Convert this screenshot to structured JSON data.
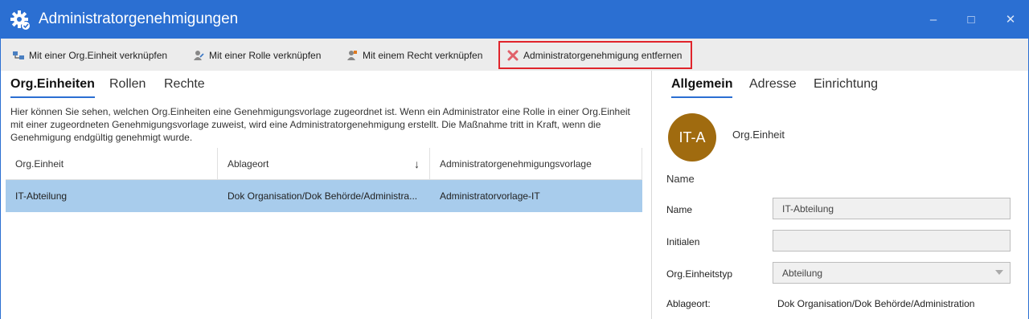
{
  "window": {
    "title": "Administratorgenehmigungen",
    "minimize_glyph": "–",
    "maximize_glyph": "□",
    "close_glyph": "✕"
  },
  "toolbar": {
    "link_org_label": "Mit einer Org.Einheit verknüpfen",
    "link_role_label": "Mit einer Rolle verknüpfen",
    "link_right_label": "Mit einem Recht verknüpfen",
    "remove_label": "Administratorgenehmigung entfernen"
  },
  "left_tabs": {
    "org": "Org.Einheiten",
    "roles": "Rollen",
    "rights": "Rechte"
  },
  "description": "Hier können Sie sehen, welchen Org.Einheiten eine Genehmigungsvorlage zugeordnet ist. Wenn ein Administrator eine Rolle in einer Org.Einheit mit einer zugeordneten Genehmigungsvorlage zuweist, wird eine Administratorgenehmigung erstellt. Die Maßnahme tritt in Kraft, wenn die Genehmigung endgültig genehmigt wurde.",
  "grid": {
    "columns": [
      "Org.Einheit",
      "Ablageort",
      "Administratorgenehmigungsvorlage"
    ],
    "sort_glyph": "↓",
    "rows": [
      {
        "org": "IT-Abteilung",
        "location": "Dok Organisation/Dok Behörde/Administra...",
        "template": "Administratorvorlage-IT"
      }
    ]
  },
  "right_tabs": {
    "general": "Allgemein",
    "address": "Adresse",
    "setup": "Einrichtung"
  },
  "detail": {
    "avatar_initials": "IT-A",
    "object_type": "Org.Einheit",
    "section_title": "Name",
    "name_label": "Name",
    "name_value": "IT-Abteilung",
    "initials_label": "Initialen",
    "initials_value": "",
    "type_label": "Org.Einheitstyp",
    "type_value": "Abteilung",
    "location_label": "Ablageort:",
    "location_value": "Dok Organisation/Dok Behörde/Administration"
  },
  "colors": {
    "titlebar": "#2b6fd2",
    "selected_row": "#a8ccec",
    "avatar": "#a06b0f",
    "highlight_border": "#e0242b"
  }
}
